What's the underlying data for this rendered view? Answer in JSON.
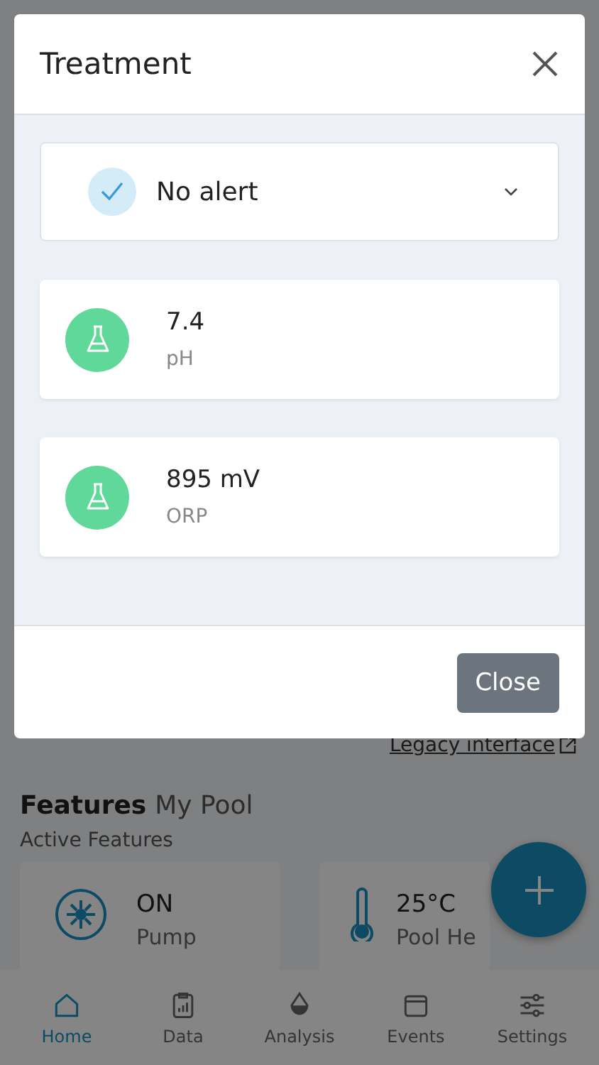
{
  "modal": {
    "title": "Treatment",
    "alert": "No alert",
    "readings": [
      {
        "value": "7.4",
        "name": "pH"
      },
      {
        "value": "895 mV",
        "name": "ORP"
      }
    ],
    "close_button": "Close"
  },
  "page": {
    "legacy_link": "Legacy interface",
    "heading": "Features",
    "pool_name": "My Pool",
    "subtitle": "Active Features",
    "features": [
      {
        "kind": "pump",
        "value": "ON",
        "name": "Pump"
      },
      {
        "kind": "thermometer",
        "value": "25°C",
        "name": "Pool He"
      }
    ]
  },
  "nav": [
    {
      "label": "Home",
      "selected": true
    },
    {
      "label": "Data",
      "selected": false
    },
    {
      "label": "Analysis",
      "selected": false
    },
    {
      "label": "Events",
      "selected": false
    },
    {
      "label": "Settings",
      "selected": false
    }
  ]
}
